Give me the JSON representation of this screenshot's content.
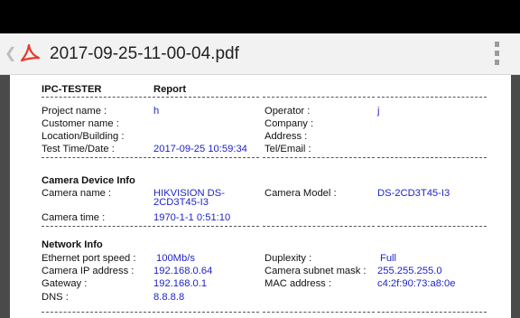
{
  "app": {
    "file_title": "2017-09-25-11-00-04.pdf"
  },
  "icons": {
    "back": "chevron-left-icon",
    "file": "pdf-icon",
    "menu": "overflow-menu-icon"
  },
  "report": {
    "heading_left": "IPC-TESTER",
    "heading_right": "Report",
    "general": {
      "project_label": "Project name :",
      "project_value": "h",
      "customer_label": "Customer name :",
      "location_label": "Location/Building :",
      "time_label": "Test Time/Date :",
      "time_value": "2017-09-25 10:59:34",
      "operator_label": "Operator :",
      "operator_value": "j",
      "company_label": "Company :",
      "address_label": "Address :",
      "tel_label": "Tel/Email :"
    },
    "camera": {
      "heading": "Camera Device Info",
      "name_label": "Camera name :",
      "name_value_line1": "HIKVISION DS-",
      "name_value_line2": "2CD3T45-I3",
      "model_label": "Camera Model :",
      "model_value": "DS-2CD3T45-I3",
      "time_label": "Camera time :",
      "time_value": "1970-1-1 0:51:10"
    },
    "network": {
      "heading": "Network Info",
      "speed_label": "Ethernet port speed :",
      "speed_value": "100Mb/s",
      "ip_label": "Camera IP address :",
      "ip_value": "192.168.0.64",
      "gateway_label": "Gateway :",
      "gateway_value": "192.168.0.1",
      "dns_label": "DNS :",
      "dns_value": "8.8.8.8",
      "duplex_label": "Duplexity :",
      "duplex_value": "Full",
      "mask_label": "Camera subnet mask :",
      "mask_value": "255.255.255.0",
      "mac_label": "MAC address :",
      "mac_value": "c4:2f:90:73:a8:0e"
    }
  }
}
